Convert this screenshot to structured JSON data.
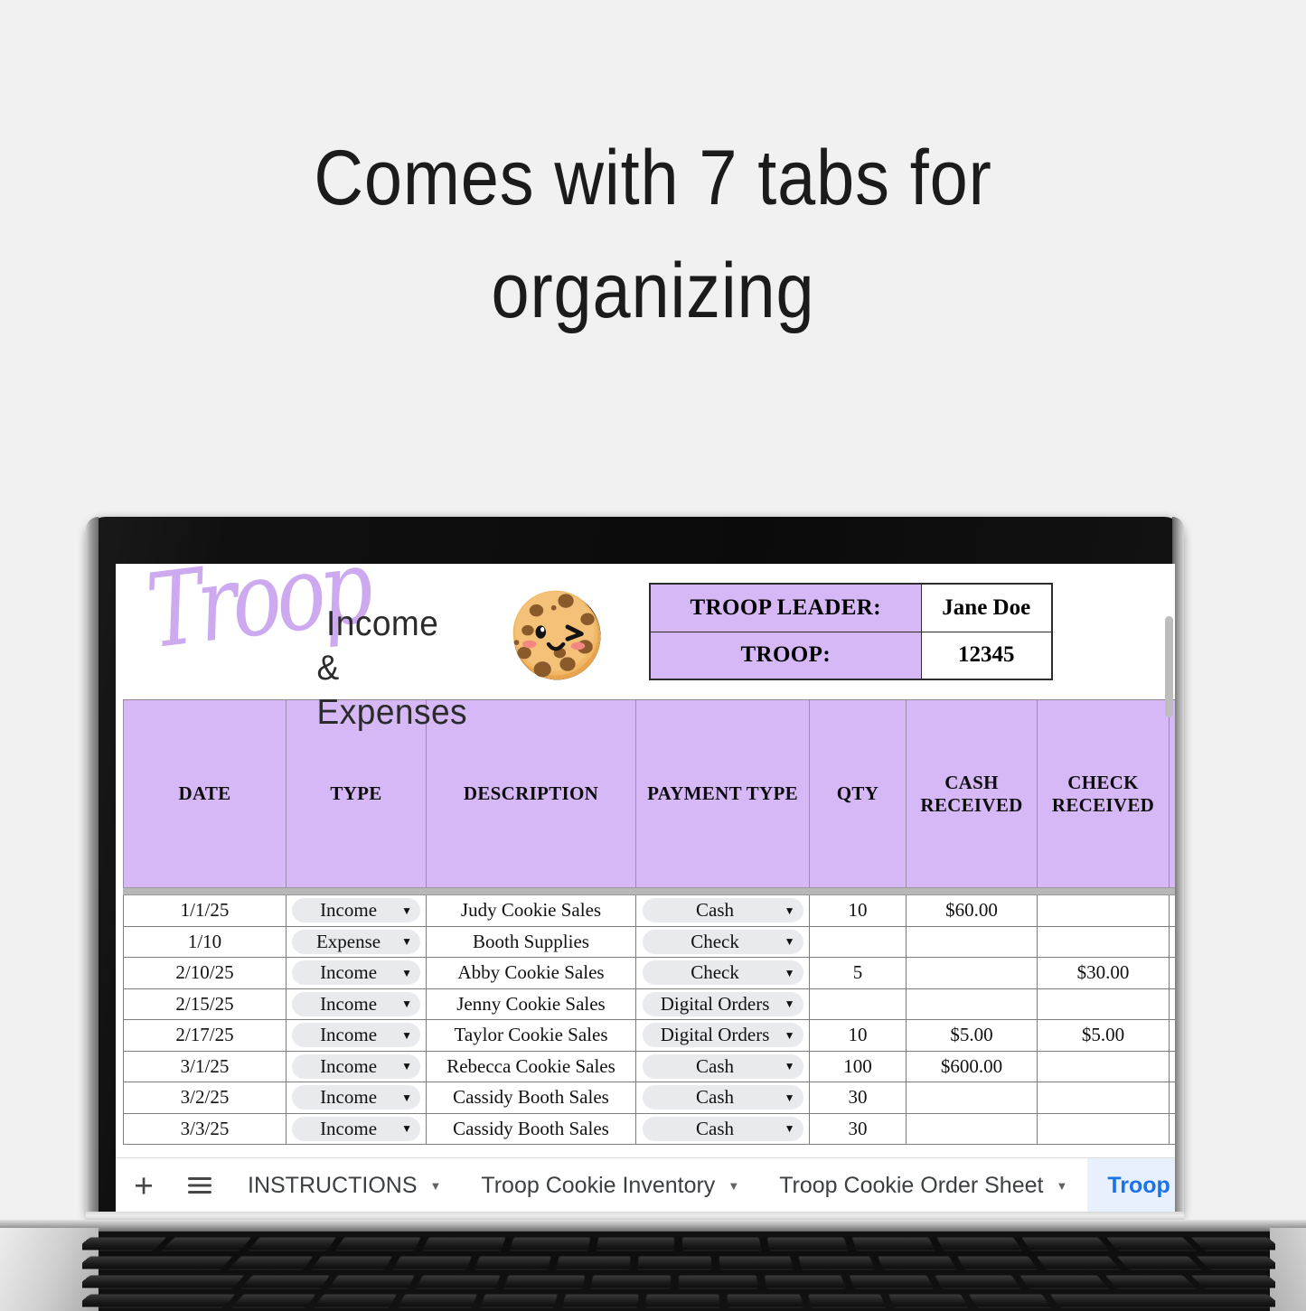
{
  "promo": {
    "line1": "Comes with 7 tabs for",
    "line2": "organizing"
  },
  "spreadsheet": {
    "logo": {
      "script_word": "Troop",
      "subtitle_line1": "Income",
      "subtitle_line2": "& Expenses",
      "mascot": "cookie-icon"
    },
    "info": {
      "leader_label": "TROOP LEADER:",
      "leader_value": "Jane Doe",
      "troop_label": "TROOP:",
      "troop_value": "12345"
    },
    "columns": [
      "DATE",
      "TYPE",
      "DESCRIPTION",
      "PAYMENT TYPE",
      "QTY",
      "CASH RECEIVED",
      "CHECK RECEIVED"
    ],
    "column_lines": {
      "cash": [
        "CASH",
        "RECEIVED"
      ],
      "check": [
        "CHECK",
        "RECEIVED"
      ]
    },
    "rows": [
      {
        "date": "1/1/25",
        "type": "Income",
        "description": "Judy Cookie Sales",
        "payment": "Cash",
        "qty": "10",
        "cash": "$60.00",
        "check": ""
      },
      {
        "date": "1/10",
        "type": "Expense",
        "description": "Booth Supplies",
        "payment": "Check",
        "qty": "",
        "cash": "",
        "check": ""
      },
      {
        "date": "2/10/25",
        "type": "Income",
        "description": "Abby Cookie Sales",
        "payment": "Check",
        "qty": "5",
        "cash": "",
        "check": "$30.00"
      },
      {
        "date": "2/15/25",
        "type": "Income",
        "description": "Jenny Cookie Sales",
        "payment": "Digital Orders",
        "qty": "",
        "cash": "",
        "check": ""
      },
      {
        "date": "2/17/25",
        "type": "Income",
        "description": "Taylor Cookie Sales",
        "payment": "Digital Orders",
        "qty": "10",
        "cash": "$5.00",
        "check": "$5.00"
      },
      {
        "date": "3/1/25",
        "type": "Income",
        "description": "Rebecca Cookie Sales",
        "payment": "Cash",
        "qty": "100",
        "cash": "$600.00",
        "check": ""
      },
      {
        "date": "3/2/25",
        "type": "Income",
        "description": "Cassidy Booth Sales",
        "payment": "Cash",
        "qty": "30",
        "cash": "",
        "check": ""
      },
      {
        "date": "3/3/25",
        "type": "Income",
        "description": "Cassidy Booth Sales",
        "payment": "Cash",
        "qty": "30",
        "cash": "",
        "check": ""
      }
    ],
    "tabbar": {
      "add_label": "+",
      "all_sheets_icon": "hamburger-icon",
      "tabs": [
        {
          "label": "INSTRUCTIONS",
          "active": false
        },
        {
          "label": "Troop Cookie Inventory",
          "active": false
        },
        {
          "label": "Troop Cookie Order Sheet",
          "active": false
        },
        {
          "label": "Troop I",
          "active": true
        }
      ]
    }
  },
  "colors": {
    "header_purple": "#d5b8f5",
    "accent_blue": "#1a73e8",
    "active_tab_bg": "#e8f0fe",
    "logo_script": "#cdaaef",
    "page_bg": "#f1f1f1"
  }
}
